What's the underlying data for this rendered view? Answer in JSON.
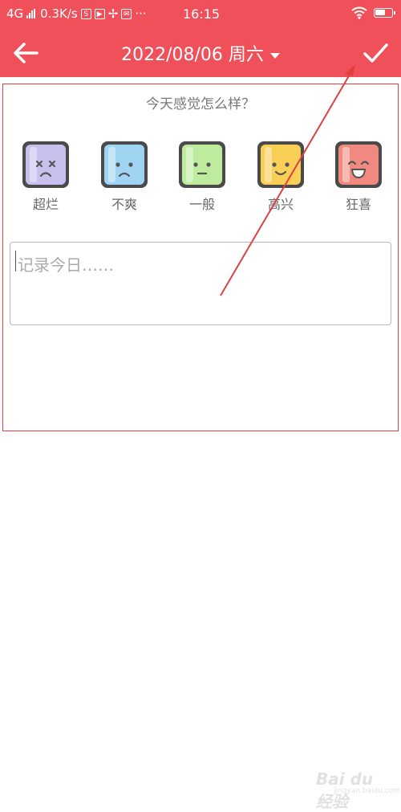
{
  "status_bar": {
    "network": "4G",
    "speed": "0.3K/s",
    "s_badge": "S",
    "more": "···",
    "time": "16:15"
  },
  "toolbar": {
    "date": "2022/08/06 周六"
  },
  "mood_section": {
    "question": "今天感觉怎么样？",
    "moods": [
      {
        "label": "超烂",
        "face": "x-eyes-frown",
        "color": "#c9c0ee"
      },
      {
        "label": "不爽",
        "face": "frown",
        "color": "#9fd4f3"
      },
      {
        "label": "一般",
        "face": "neutral",
        "color": "#bfeb9e"
      },
      {
        "label": "高兴",
        "face": "smile",
        "color": "#f9cf55"
      },
      {
        "label": "狂喜",
        "face": "big-grin",
        "color": "#f08a80"
      }
    ]
  },
  "note": {
    "placeholder": "记录今日……"
  },
  "watermark": {
    "brand": "Bai du 经验",
    "sub": "jingyan.baidu.com"
  },
  "colors": {
    "header": "#f0505a",
    "annotation": "#e04040"
  }
}
